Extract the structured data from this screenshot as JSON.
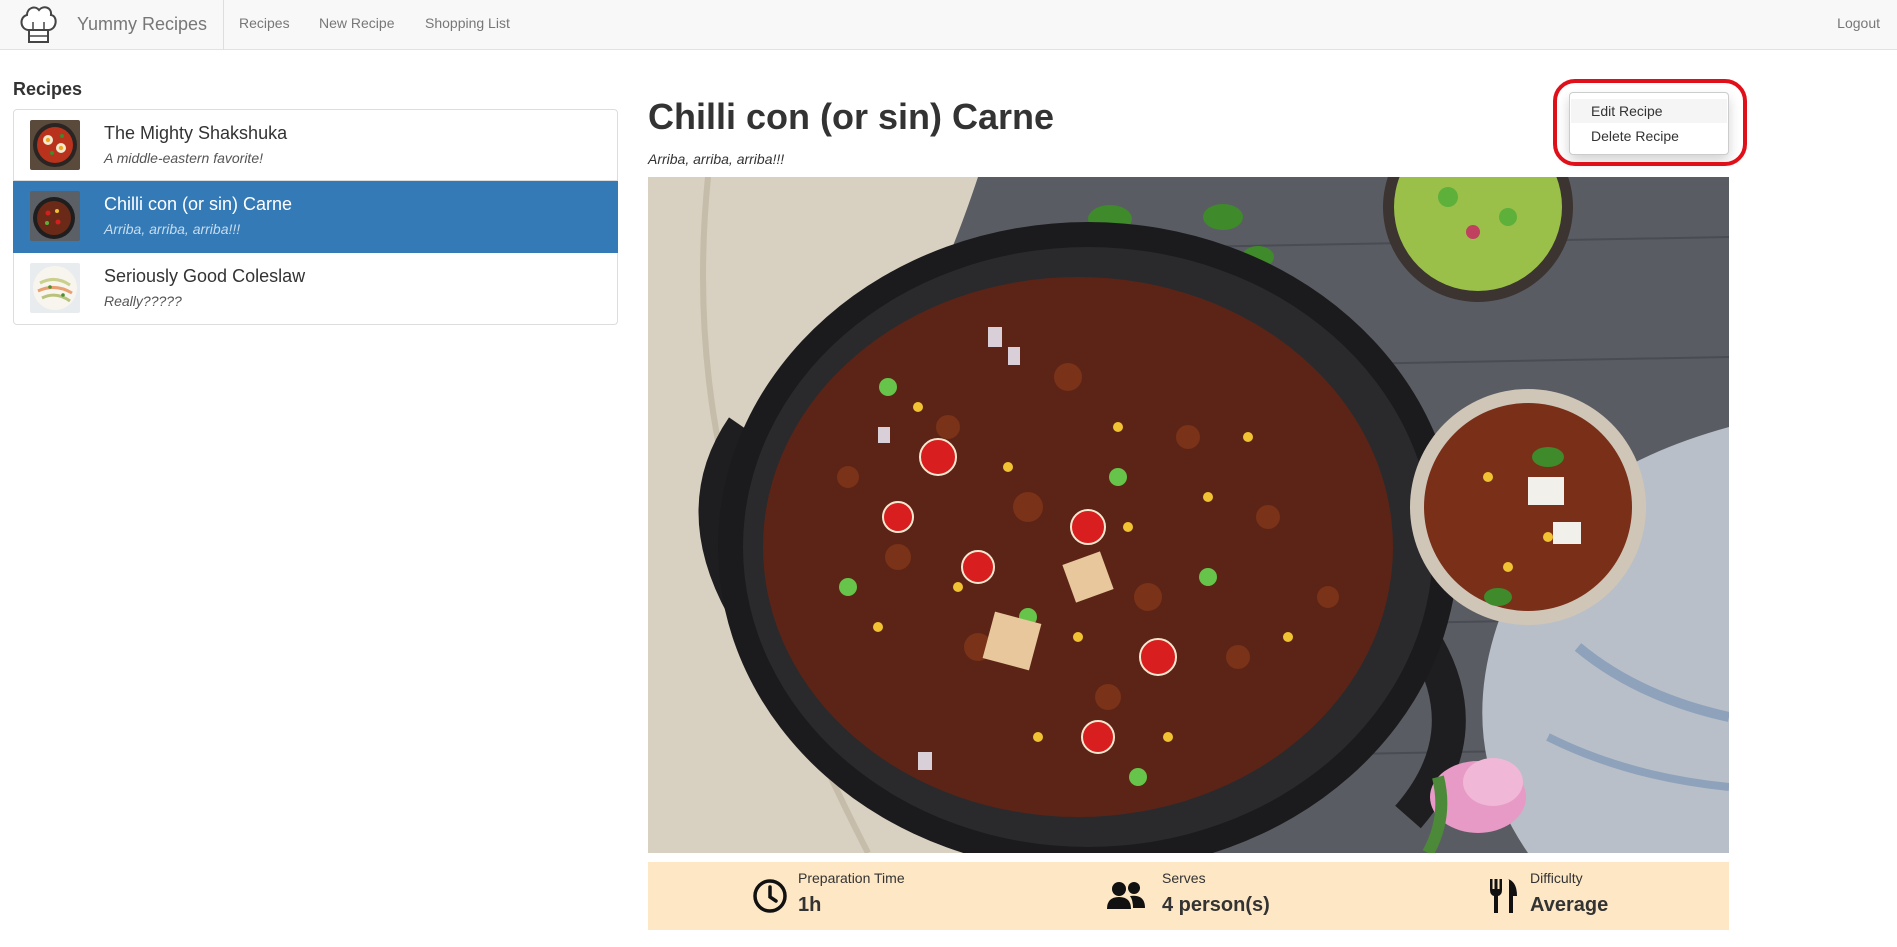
{
  "app": {
    "brand": "Yummy Recipes",
    "brand_icon": "chef-hat-icon"
  },
  "nav": {
    "recipes": "Recipes",
    "new_recipe": "New Recipe",
    "shopping_list": "Shopping List",
    "logout": "Logout"
  },
  "sidebar": {
    "heading": "Recipes",
    "items": [
      {
        "title": "The Mighty Shakshuka",
        "description": "A middle-eastern favorite!",
        "active": false,
        "thumb": "shakshuka-thumbnail"
      },
      {
        "title": "Chilli con (or sin) Carne",
        "description": "Arriba, arriba, arriba!!!",
        "active": true,
        "thumb": "chilli-thumbnail"
      },
      {
        "title": "Seriously Good Coleslaw",
        "description": "Really?????",
        "active": false,
        "thumb": "coleslaw-thumbnail"
      }
    ]
  },
  "recipe": {
    "title": "Chilli con (or sin) Carne",
    "subtitle": "Arriba, arriba, arriba!!!",
    "image": "chilli-pot-photo"
  },
  "menu": {
    "edit": "Edit Recipe",
    "delete": "Delete Recipe"
  },
  "info": {
    "prep_label": "Preparation Time",
    "prep_value": "1h",
    "prep_icon": "clock-icon",
    "serves_label": "Serves",
    "serves_value": "4 person(s)",
    "serves_icon": "people-icon",
    "difficulty_label": "Difficulty",
    "difficulty_value": "Average",
    "difficulty_icon": "utensils-icon"
  },
  "colors": {
    "active_item": "#337ab7",
    "info_bar": "#fde7c5",
    "highlight_ring": "#e0101a"
  }
}
